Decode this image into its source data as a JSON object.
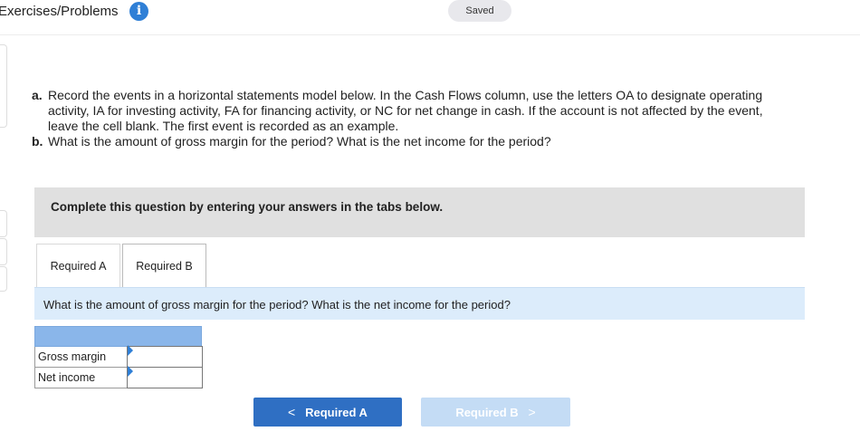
{
  "header": {
    "title": "Exercises/Problems",
    "info_icon": "info-icon",
    "status": "Saved"
  },
  "instructions": {
    "a_lead": "a.",
    "a_text_1": "Record the events in a horizontal statements model below. In the Cash Flows column, use the letters OA to designate operating",
    "a_text_2": "activity, IA for investing activity, FA for financing activity, or NC for net change in cash. If the account is not affected by the event,",
    "a_text_3": "leave the cell blank. The first event is recorded as an example.",
    "b_lead": "b.",
    "b_text": "What is the amount of gross margin for the period? What is the net income for the period?"
  },
  "prompt": "Complete this question by entering your answers in the tabs below.",
  "tabs": [
    {
      "label": "Required A",
      "active": false
    },
    {
      "label": "Required B",
      "active": true
    }
  ],
  "question": "What is the amount of gross margin for the period? What is the net income for the period?",
  "answer_table": {
    "rows": [
      {
        "label": "Gross margin",
        "value": ""
      },
      {
        "label": "Net income",
        "value": ""
      }
    ]
  },
  "navigation": {
    "prev_label": "Required A",
    "prev_chevron": "<",
    "next_label": "Required B",
    "next_chevron": ">"
  },
  "colors": {
    "accent": "#2f6fc3",
    "info_icon": "#2f7fd6",
    "question_bar": "#dcecfb",
    "table_header": "#8ab6ea",
    "next_button_disabled": "#c4dcf5"
  }
}
